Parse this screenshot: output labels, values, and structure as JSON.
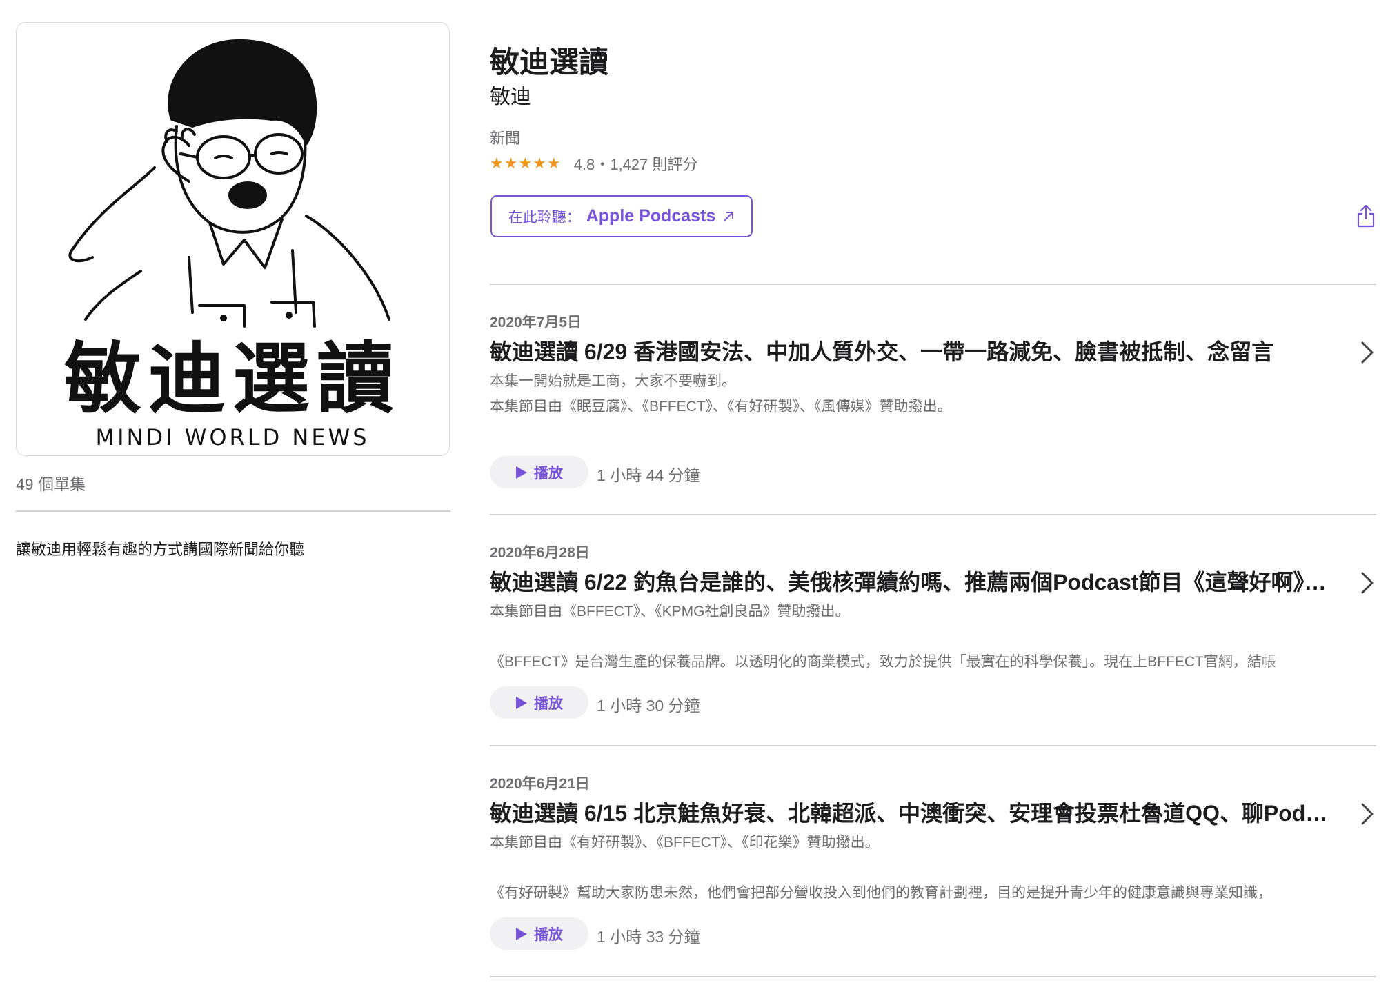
{
  "podcast": {
    "title": "敏迪選讀",
    "author": "敏迪",
    "genre": "新聞",
    "stars": "★★★★★",
    "rating": "4.8・1,427 則評分",
    "episode_count": "49 個單集",
    "description": "讓敏迪用輕鬆有趣的方式講國際新聞給你聽",
    "listen_prefix": "在此聆聽：",
    "listen_brand": "Apple Podcasts",
    "accent_color": "#7653d8",
    "star_color": "#f0941e"
  },
  "artwork": {
    "title_text": "敏迪選讀",
    "subtitle_text": "MINDI WORLD NEWS"
  },
  "episodes": [
    {
      "date": "2020年7月5日",
      "title": "敏迪選讀 6/29 香港國安法、中加人質外交、一帶一路減免、臉書被抵制、念留言",
      "line1": "本集一開始就是工商，大家不要嚇到。",
      "line2": "本集節目由《眠豆腐》、《BFFECT》、《有好研製》、《風傳媒》贊助撥出。",
      "play_label": "播放",
      "duration": "1 小時 44 分鐘"
    },
    {
      "date": "2020年6月28日",
      "title": "敏迪選讀 6/22 釣魚台是誰的、美俄核彈續約嗎、推薦兩個Podcast節目《這聲好啊》、《小貓日常》",
      "line1": "本集節目由《BFFECT》、《KPMG社創良品》贊助撥出。",
      "line2": "《BFFECT》是台灣生產的保養品牌。以透明化的商業模式，致力於提供「最實在的科學保養」。現在上BFFECT官網，結帳",
      "play_label": "播放",
      "duration": "1 小時 30 分鐘"
    },
    {
      "date": "2020年6月21日",
      "title": "敏迪選讀 6/15 北京鮭魚好衰、北韓超派、中澳衝突、安理會投票杜魯道QQ、聊Podcast",
      "line1": "本集節目由《有好研製》、《BFFECT》、《印花樂》贊助撥出。",
      "line2": "《有好研製》幫助大家防患未然，他們會把部分營收投入到他們的教育計劃裡，目的是提升青少年的健康意識與專業知識，",
      "play_label": "播放",
      "duration": "1 小時 33 分鐘"
    }
  ]
}
